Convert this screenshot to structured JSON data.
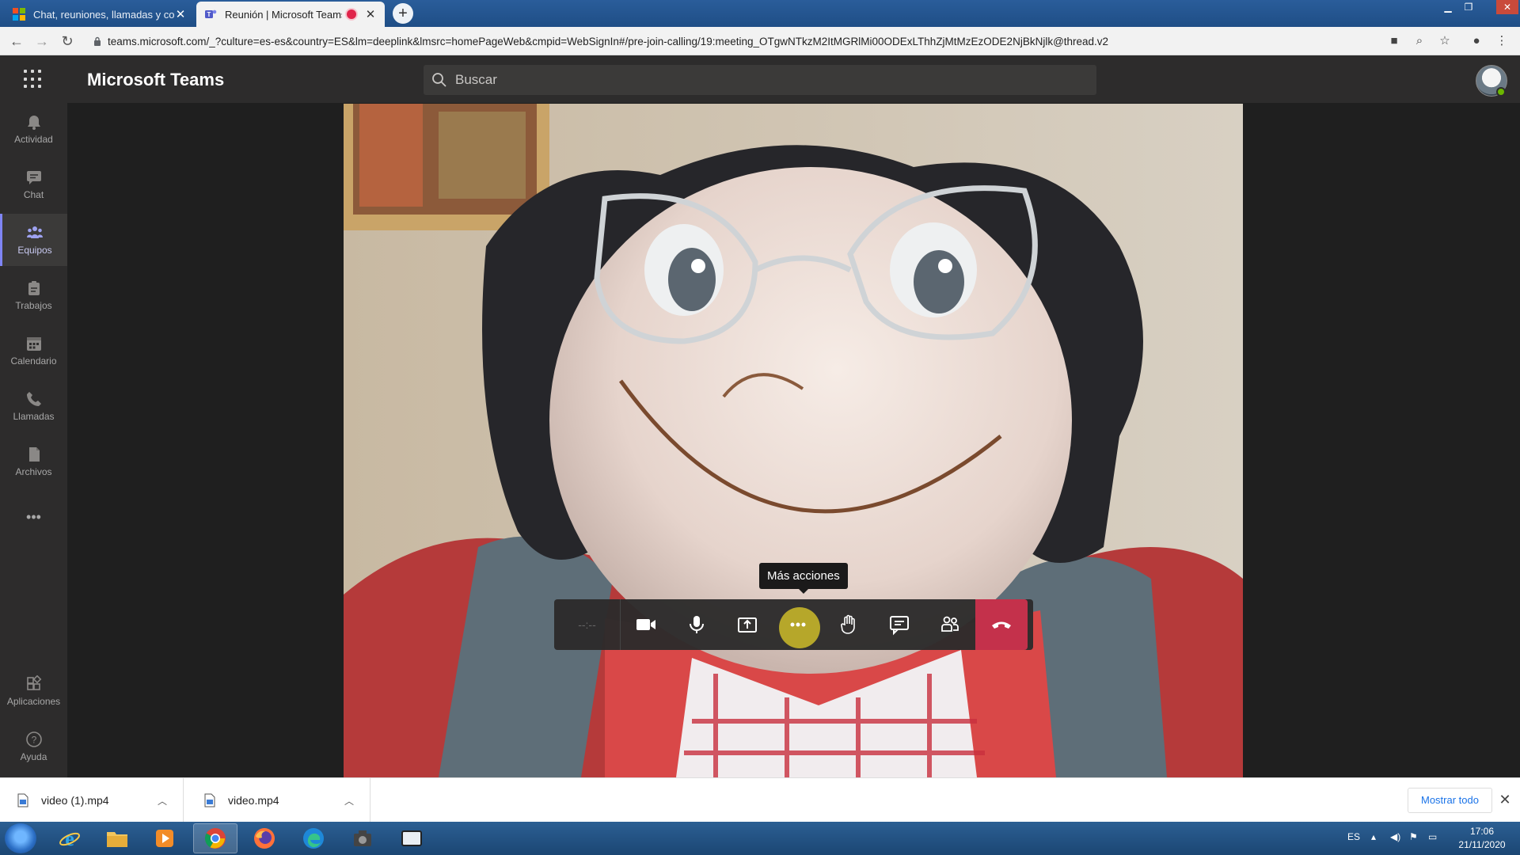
{
  "browser": {
    "tabs": [
      {
        "label": "Chat, reuniones, llamadas y colab",
        "active": false
      },
      {
        "label": "Reunión | Microsoft Teams",
        "active": true,
        "recording": true
      }
    ],
    "new_tab_label": "+",
    "url": "teams.microsoft.com/_?culture=es-es&country=ES&lm=deeplink&lmsrc=homePageWeb&cmpid=WebSignIn#/pre-join-calling/19:meeting_OTgwNTkzM2ItMGRlMi00ODExLThhZjMtMzEzODE2NjBkNjlk@thread.v2"
  },
  "teams": {
    "app_title": "Microsoft Teams",
    "search_placeholder": "Buscar",
    "rail": [
      {
        "label": "Actividad",
        "icon": "bell-icon"
      },
      {
        "label": "Chat",
        "icon": "chat-icon"
      },
      {
        "label": "Equipos",
        "icon": "teams-icon",
        "active": true
      },
      {
        "label": "Trabajos",
        "icon": "assignments-icon"
      },
      {
        "label": "Calendario",
        "icon": "calendar-icon"
      },
      {
        "label": "Llamadas",
        "icon": "phone-icon"
      },
      {
        "label": "Archivos",
        "icon": "file-icon"
      },
      {
        "label": "•••",
        "icon": "more-icon"
      }
    ],
    "rail_bottom": [
      {
        "label": "Aplicaciones",
        "icon": "apps-icon"
      },
      {
        "label": "Ayuda",
        "icon": "help-icon"
      }
    ]
  },
  "call": {
    "timer": "--:--",
    "tooltip": "Más acciones",
    "toolbar": [
      "camera-icon",
      "mic-icon",
      "share-screen-icon",
      "more-actions-icon",
      "raise-hand-icon",
      "chat-icon",
      "participants-icon",
      "hang-up-icon"
    ]
  },
  "downloads": {
    "items": [
      {
        "name": "video (1).mp4"
      },
      {
        "name": "video.mp4"
      }
    ],
    "show_all": "Mostrar todo"
  },
  "taskbar": {
    "lang": "ES",
    "time": "17:06",
    "date": "21/11/2020"
  },
  "colors": {
    "teams_dark": "#2d2c2c",
    "stage": "#1f1f1f",
    "accent": "#7f85f5",
    "hangup": "#c4314b",
    "recording": "#e0244a",
    "highlight": "#c4b52a"
  }
}
